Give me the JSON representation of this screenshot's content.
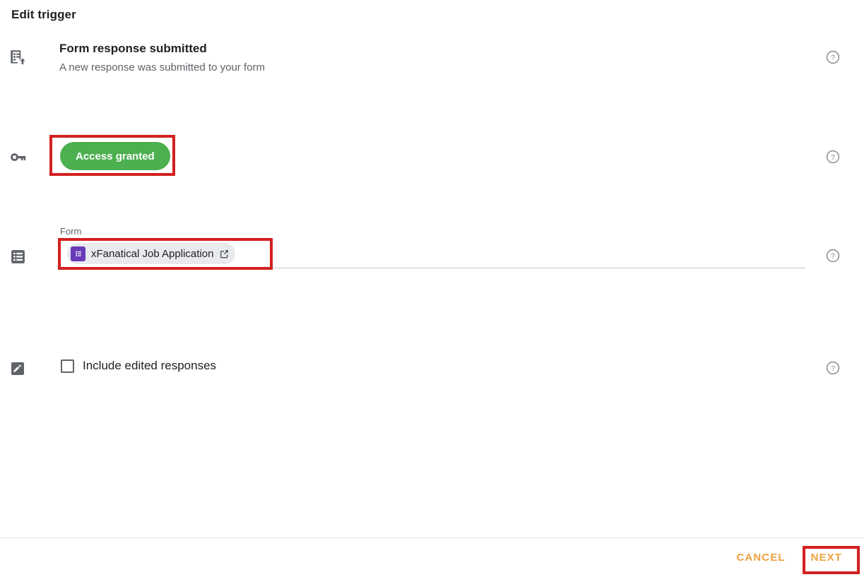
{
  "header": {
    "title": "Edit trigger"
  },
  "rows": [
    {
      "id": "trigger",
      "icon": "form-submit-icon",
      "title": "Form response submitted",
      "subtitle": "A new response was submitted to your form",
      "help_icon": "help-circle-icon"
    },
    {
      "id": "access",
      "icon": "key-icon",
      "button_label": "Access granted",
      "help_icon": "help-circle-icon"
    },
    {
      "id": "form",
      "icon": "list-icon",
      "field_label": "Form",
      "chip_label": "xFanatical Job Application",
      "chip_icon": "google-forms-icon",
      "chip_external_icon": "open-in-new-icon",
      "help_icon": "help-circle-icon"
    },
    {
      "id": "check",
      "icon": "edit-pencil-icon",
      "checkbox_label": "Include edited responses",
      "checked": false,
      "help_icon": "help-circle-icon"
    }
  ],
  "footer": {
    "cancel_label": "CANCEL",
    "next_label": "NEXT"
  },
  "colors": {
    "access_green": "#4caf50",
    "highlight_red": "#d32020",
    "action_orange": "#eda13f",
    "forms_purple": "#673ab7",
    "chip_gray": "#e8eaed",
    "icon_gray": "#5f6368"
  }
}
